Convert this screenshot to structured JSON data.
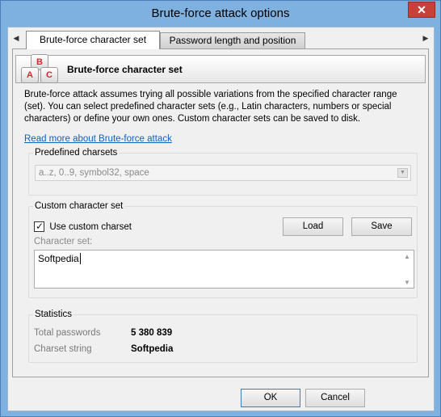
{
  "window": {
    "title": "Brute-force attack options",
    "close_label": "✕"
  },
  "tabs": [
    {
      "label": "Brute-force character set",
      "active": true
    },
    {
      "label": "Password length and position",
      "active": false
    }
  ],
  "tab_scroll": {
    "left": "◀",
    "right": "▶"
  },
  "header": {
    "title": "Brute-force character set",
    "icon_keys": [
      "B",
      "A",
      "C"
    ],
    "icon_name": "abc-keys-icon"
  },
  "description": "Brute-force attack assumes trying all possible variations from the specified character range (set). You can select predefined character sets (e.g., Latin characters, numbers or special characters) or define your own ones. Custom character sets can be saved to disk.",
  "link_text": "Read more about Brute-force attack",
  "predefined": {
    "label": "Predefined charsets",
    "value": "a..z, 0..9, symbol32, space",
    "arrow": "▼"
  },
  "custom": {
    "label": "Custom character set",
    "use_custom_label": "Use custom charset",
    "use_custom_checked": true,
    "check_glyph": "✓",
    "load_label": "Load",
    "save_label": "Save",
    "charset_label": "Character set:",
    "charset_value": "Softpedia",
    "scroll_up": "▲",
    "scroll_down": "▼"
  },
  "statistics": {
    "label": "Statistics",
    "total_label": "Total passwords",
    "total_value": "5 380 839",
    "charset_string_label": "Charset string",
    "charset_string_value": "Softpedia"
  },
  "dialog_buttons": {
    "ok_label": "OK",
    "cancel_label": "Cancel"
  },
  "colors": {
    "title_bar": "#7eb1e0",
    "close_button": "#c7413b",
    "link": "#0b62c4",
    "key_letters": "#d8262c"
  }
}
